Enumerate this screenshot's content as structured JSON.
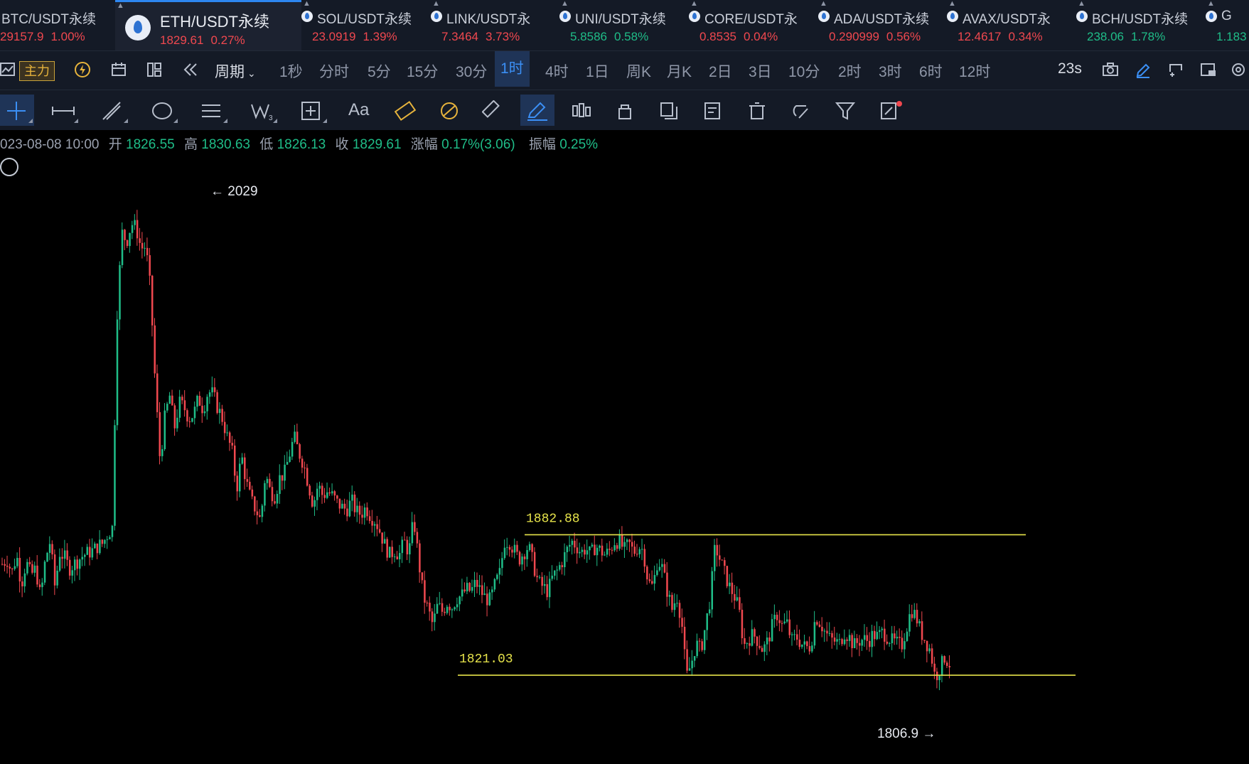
{
  "tabs": [
    {
      "name": "BTC/USDT永续",
      "price": "29157.9",
      "change": "1.00%",
      "dir": "up"
    },
    {
      "name": "ETH/USDT永续",
      "price": "1829.61",
      "change": "0.27%",
      "dir": "up"
    },
    {
      "name": "SOL/USDT永续",
      "price": "23.0919",
      "change": "1.39%",
      "dir": "up"
    },
    {
      "name": "LINK/USDT永",
      "price": "7.3464",
      "change": "3.73%",
      "dir": "up"
    },
    {
      "name": "UNI/USDT永续",
      "price": "5.8586",
      "change": "0.58%",
      "dir": "dn"
    },
    {
      "name": "CORE/USDT永",
      "price": "0.8535",
      "change": "0.04%",
      "dir": "up"
    },
    {
      "name": "ADA/USDT永续",
      "price": "0.290999",
      "change": "0.56%",
      "dir": "up"
    },
    {
      "name": "AVAX/USDT永",
      "price": "12.4617",
      "change": "0.34%",
      "dir": "up"
    },
    {
      "name": "BCH/USDT永续",
      "price": "238.06",
      "change": "1.78%",
      "dir": "dn"
    },
    {
      "name": "G",
      "price": "1.183",
      "change": "",
      "dir": "dn"
    }
  ],
  "toolbar": {
    "indicator_label": "主力",
    "period_label": "周期",
    "intervals": [
      "1秒",
      "分时",
      "5分",
      "15分",
      "30分",
      "1时",
      "4时",
      "1日",
      "周K",
      "月K",
      "2日",
      "3日",
      "10分",
      "2时",
      "3时",
      "6时",
      "12时"
    ],
    "active_interval": "1时",
    "countdown": "23s"
  },
  "drawing_tools": {
    "text_tool_label": "Aa"
  },
  "ohlc": {
    "date": "023-08-08 10:00",
    "open_label": "开",
    "open": "1826.55",
    "high_label": "高",
    "high": "1830.63",
    "low_label": "低",
    "low": "1826.13",
    "close_label": "收",
    "close": "1829.61",
    "change_label": "涨幅",
    "change": "0.17%(3.06)",
    "amp_label": "振幅",
    "amp": "0.25%"
  },
  "colors": {
    "up": "#f0484f",
    "down": "#1fbd88",
    "accent": "#3b8ff5",
    "level_line": "#e6e34a"
  },
  "chart_data": {
    "type": "candlestick",
    "annotations": {
      "high_marker": "2029",
      "low_marker": "1806.9"
    },
    "levels": [
      {
        "label": "1882.88",
        "value": 1882.88
      },
      {
        "label": "1821.03",
        "value": 1821.03
      }
    ],
    "y_range": [
      1796,
      2037
    ],
    "close_path": [
      1870,
      1872,
      1866,
      1874,
      1861,
      1871,
      1865,
      1868,
      1855,
      1872,
      1880,
      1860,
      1875,
      1873,
      1868,
      1870,
      1872,
      1874,
      1875,
      1876,
      1878,
      1879,
      1883,
      1886,
      1980,
      2016,
      2012,
      2020,
      2018,
      2009,
      2010,
      1990,
      1948,
      1915,
      1935,
      1944,
      1930,
      1941,
      1939,
      1934,
      1936,
      1943,
      1938,
      1946,
      1945,
      1939,
      1934,
      1926,
      1920,
      1903,
      1918,
      1906,
      1898,
      1894,
      1889,
      1910,
      1902,
      1900,
      1908,
      1910,
      1918,
      1926,
      1919,
      1914,
      1905,
      1896,
      1905,
      1900,
      1902,
      1900,
      1897,
      1895,
      1894,
      1898,
      1893,
      1892,
      1895,
      1891,
      1889,
      1884,
      1878,
      1874,
      1876,
      1874,
      1880,
      1875,
      1890,
      1872,
      1856,
      1850,
      1843,
      1852,
      1849,
      1853,
      1851,
      1855,
      1856,
      1859,
      1858,
      1862,
      1858,
      1855,
      1854,
      1861,
      1866,
      1880,
      1880,
      1876,
      1872,
      1875,
      1878,
      1870,
      1862,
      1860,
      1858,
      1864,
      1867,
      1871,
      1876,
      1880,
      1878,
      1875,
      1877,
      1874,
      1878,
      1876,
      1874,
      1876,
      1880,
      1880,
      1876,
      1879,
      1875,
      1878,
      1876,
      1862,
      1860,
      1872,
      1868,
      1858,
      1850,
      1856,
      1845,
      1820,
      1826,
      1835,
      1832,
      1843,
      1855,
      1878,
      1872,
      1866,
      1860,
      1856,
      1850,
      1834,
      1837,
      1839,
      1836,
      1832,
      1836,
      1843,
      1848,
      1843,
      1844,
      1836,
      1838,
      1835,
      1833,
      1834,
      1847,
      1844,
      1840,
      1837,
      1836,
      1835,
      1840,
      1838,
      1834,
      1836,
      1837,
      1836,
      1839,
      1838,
      1840,
      1838,
      1836,
      1835,
      1834,
      1842,
      1850,
      1847,
      1840,
      1836,
      1832,
      1820,
      1824,
      1829,
      1826
    ]
  }
}
